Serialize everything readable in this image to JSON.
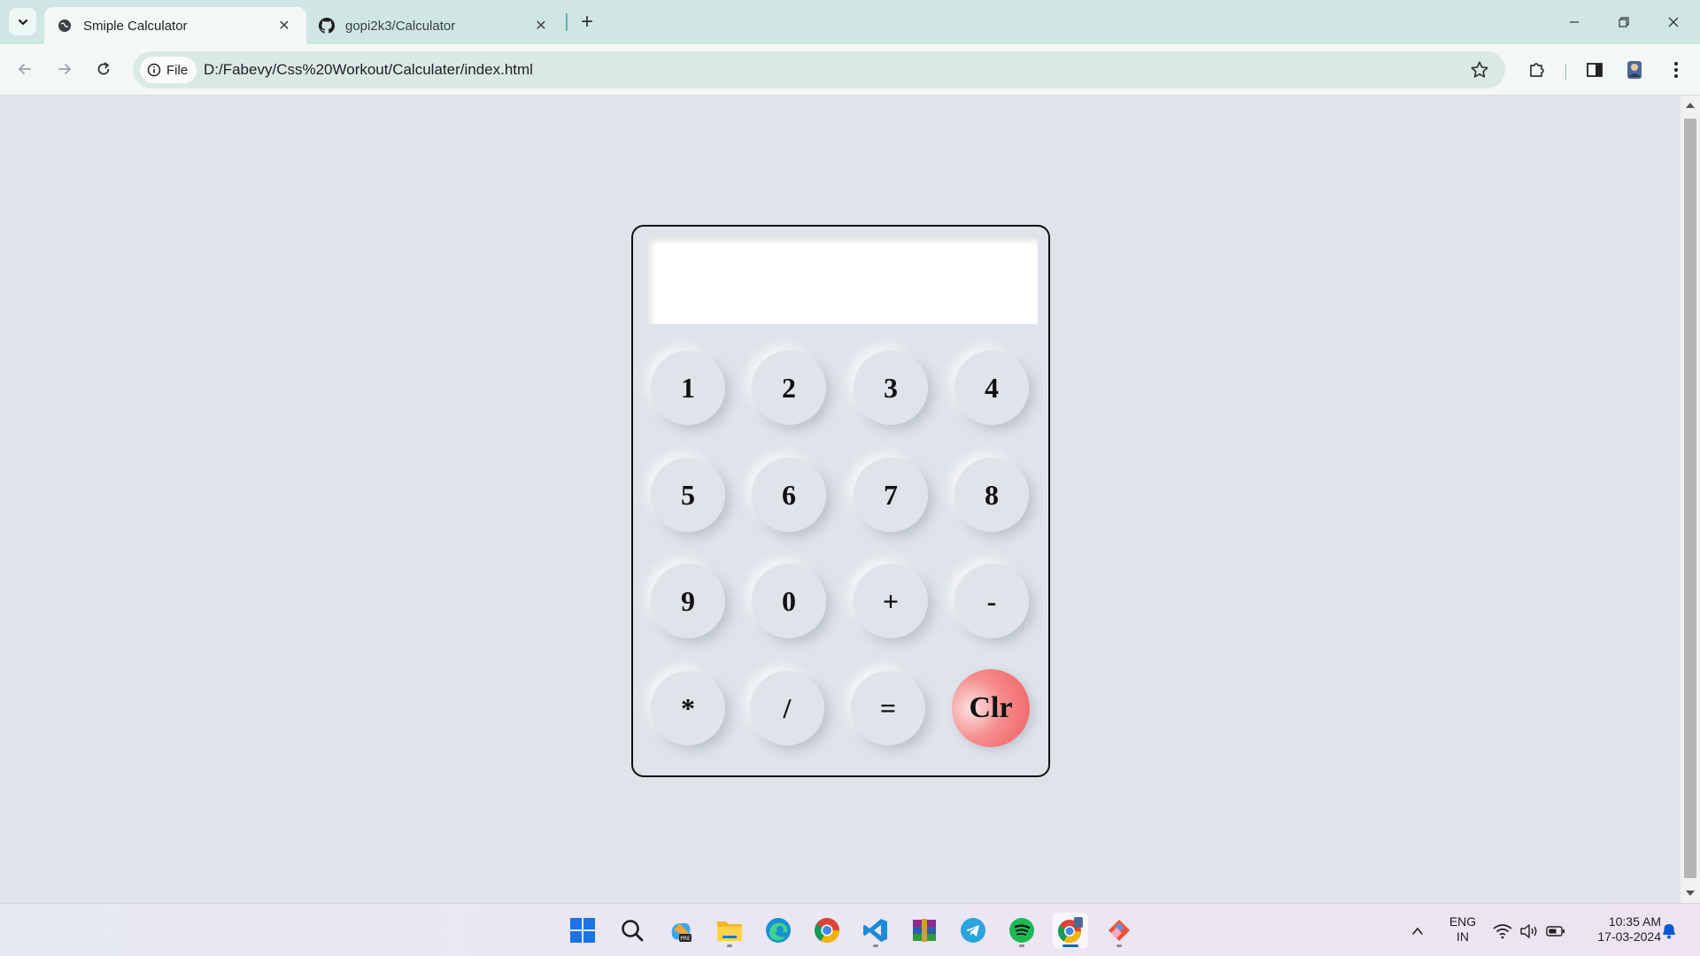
{
  "browser": {
    "tabs": [
      {
        "title": "Smiple Calculator",
        "active": true
      },
      {
        "title": "gopi2k3/Calculator",
        "active": false
      }
    ],
    "address": {
      "scheme_chip": "File",
      "url": "D:/Fabevy/Css%20Workout/Calculater/index.html"
    }
  },
  "calculator": {
    "display_value": "",
    "keys": [
      "1",
      "2",
      "3",
      "4",
      "5",
      "6",
      "7",
      "8",
      "9",
      "0",
      "+",
      "-",
      "*",
      "/",
      "=",
      "Clr"
    ],
    "clear_color": "#ef5d62"
  },
  "taskbar": {
    "apps": [
      "start-icon",
      "search-icon",
      "copilot-icon",
      "file-explorer-icon",
      "edge-icon",
      "chrome-icon",
      "vscode-icon",
      "winrar-icon",
      "telegram-icon",
      "spotify-icon",
      "chrome-profile-icon",
      "git-icon"
    ],
    "tray": {
      "language": "ENG",
      "region": "IN",
      "time": "10:35 AM",
      "date": "17-03-2024"
    }
  },
  "colors": {
    "tabstrip": "#cfe6e2",
    "toolbar": "#f3f8f7",
    "page_bg": "#dfe3ea",
    "accent": "#0067c0"
  }
}
